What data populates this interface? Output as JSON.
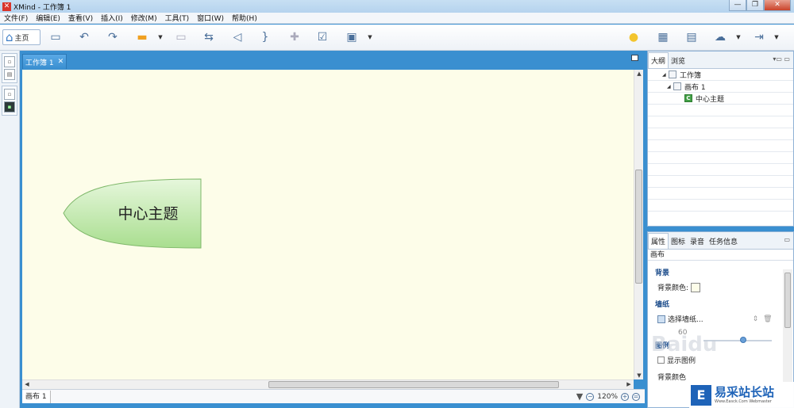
{
  "window": {
    "title": "XMind - 工作簿 1",
    "controls": [
      "—",
      "❐",
      "✕"
    ]
  },
  "menu": [
    "文件(F)",
    "编辑(E)",
    "查看(V)",
    "插入(I)",
    "修改(M)",
    "工具(T)",
    "窗口(W)",
    "帮助(H)"
  ],
  "toolbar": {
    "home_label": "主页"
  },
  "editor": {
    "tab_label": "工作簿 1",
    "tab_close": "✕"
  },
  "canvas": {
    "background": "#fdfde9",
    "central_topic": "中心主题"
  },
  "status": {
    "sheet_tab": "画布 1",
    "zoom": "120%"
  },
  "outline": {
    "tabs": [
      "大纲",
      "浏览"
    ],
    "tree": [
      {
        "label": "工作簿",
        "level": 0
      },
      {
        "label": "画布 1",
        "level": 1
      },
      {
        "label": "中心主题",
        "level": 2
      }
    ]
  },
  "properties": {
    "tabs": [
      "属性",
      "图标",
      "录音",
      "任务信息"
    ],
    "subtitle": "画布",
    "background_section": "背景",
    "background_color_label": "背景颜色:",
    "wallpaper_section": "墙纸",
    "wallpaper_select": "选择墙纸...",
    "opacity_value": "60",
    "legend_section": "图例",
    "show_legend": "显示图例",
    "legend_bg_label": "背景颜色"
  },
  "watermark": {
    "baidu": "Baidu",
    "logo": "E",
    "text": "易采站长站",
    "sub": "Www.Easck.Com Webmaster"
  },
  "colors": {
    "accent": "#3a8fd0",
    "topic_fill": "#c6ebb4",
    "topic_stroke": "#7fb86a",
    "canvas": "#fdfde9"
  }
}
